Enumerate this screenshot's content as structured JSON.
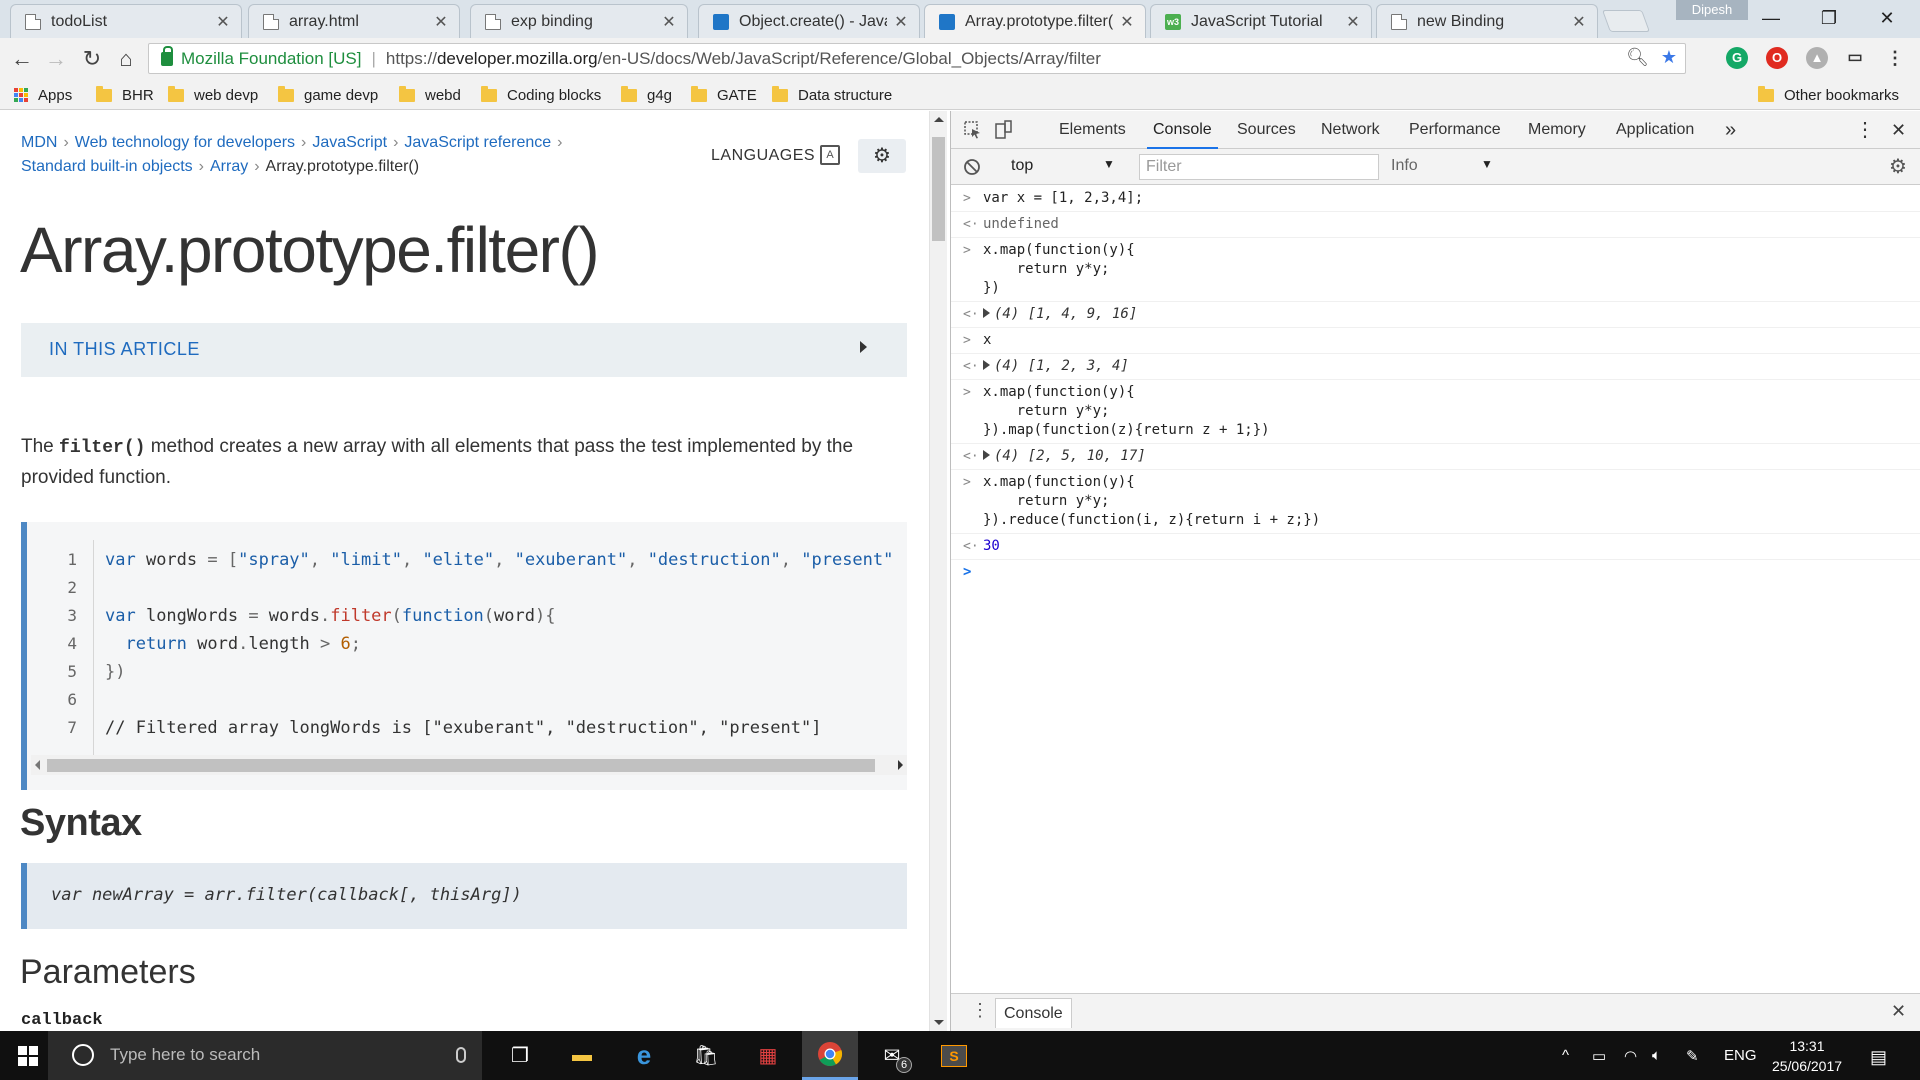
{
  "browser": {
    "tabs": [
      {
        "title": "todoList",
        "icon": "doc-icon"
      },
      {
        "title": "array.html",
        "icon": "doc-icon"
      },
      {
        "title": "exp binding",
        "icon": "doc-icon"
      },
      {
        "title": "Object.create() - JavaS",
        "icon": "mdn-icon"
      },
      {
        "title": "Array.prototype.filter()",
        "icon": "mdn-icon",
        "active": true
      },
      {
        "title": "JavaScript Tutorial",
        "icon": "w3-icon"
      },
      {
        "title": "new Binding",
        "icon": "doc-icon"
      }
    ],
    "tab_close": "✕",
    "profile": "Dipesh",
    "org": "Mozilla Foundation [US]",
    "url_scheme": "https://",
    "url_host": "developer.mozilla.org",
    "url_path": "/en-US/docs/Web/JavaScript/Reference/Global_Objects/Array/filter"
  },
  "bookmarks": {
    "apps": "Apps",
    "items": [
      "BHR",
      "web devp",
      "game devp",
      "webd",
      "Coding blocks",
      "g4g",
      "GATE",
      "Data structure"
    ],
    "other": "Other bookmarks"
  },
  "page": {
    "breadcrumb": {
      "mdn": "MDN",
      "web": "Web technology for developers",
      "js": "JavaScript",
      "ref": "JavaScript reference",
      "builtins": "Standard built-in objects",
      "array": "Array",
      "current": "Array.prototype.filter()",
      "sep": "›"
    },
    "languages": "LANGUAGES",
    "title": "Array.prototype.filter()",
    "in_this_article": "IN THIS ARTICLE",
    "intro_pre": "The ",
    "intro_code": "filter()",
    "intro_post": " method creates a new array with all elements that pass the test implemented by the provided function.",
    "line_numbers": [
      "1",
      "2",
      "3",
      "4",
      "5",
      "6",
      "7"
    ],
    "syntax_heading": "Syntax",
    "syntax_line": "var newArray = arr.filter(callback[, thisArg])",
    "parameters_heading": "Parameters",
    "param_name": "callback"
  },
  "devtools": {
    "tabs": [
      "Elements",
      "Console",
      "Sources",
      "Network",
      "Performance",
      "Memory",
      "Application"
    ],
    "active_tab": "Console",
    "more": "»",
    "context": "top",
    "filter_placeholder": "Filter",
    "level": "Info",
    "drawer_tab": "Console",
    "console": {
      "r1_in": "var x = [1, 2,3,4];",
      "r1_out": "undefined",
      "r2_in_a": "x.map(function(y){",
      "r2_in_b": "    return y*y;",
      "r2_in_c": "})",
      "r2_out": "(4) [1, 4, 9, 16]",
      "r3_in": "x",
      "r3_out": "(4) [1, 2, 3, 4]",
      "r4_in_a": "x.map(function(y){",
      "r4_in_b": "    return y*y;",
      "r4_in_c": "}).map(function(z){return z + 1;})",
      "r4_out": "(4) [2, 5, 10, 17]",
      "r5_in_a": "x.map(function(y){",
      "r5_in_b": "    return y*y;",
      "r5_in_c": "}).reduce(function(i, z){return i + z;})",
      "r5_out": "30"
    }
  },
  "taskbar": {
    "search_placeholder": "Type here to search",
    "mail_badge": "6",
    "lang": "ENG",
    "time": "13:31",
    "date": "25/06/2017"
  }
}
